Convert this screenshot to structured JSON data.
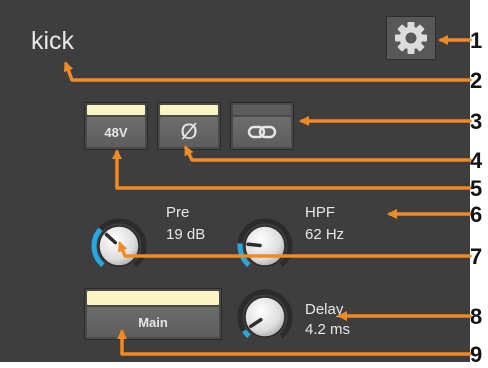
{
  "channel": {
    "name": "kick"
  },
  "buttons": {
    "phantom": {
      "label": "48V"
    },
    "polarity": {
      "glyph": "Ø"
    },
    "link": {
      "icon": "link-icon"
    },
    "output": {
      "label": "Main"
    }
  },
  "knobs": {
    "preamp": {
      "label": "Pre",
      "value": "19 dB",
      "level": 0.33
    },
    "hpf": {
      "label": "HPF",
      "value": "62 Hz",
      "level": 0.2
    },
    "delay": {
      "label": "Delay",
      "value": "4.2 ms",
      "level": 0.06
    }
  },
  "callouts": [
    "1",
    "2",
    "3",
    "4",
    "5",
    "6",
    "7",
    "8",
    "9"
  ],
  "colors": {
    "panel": "#3e3e3e",
    "lamp_on": "#fbf5c6",
    "lamp_off": "#5c5c5c",
    "arc": "#28a8e0",
    "annotation": "#f08a24"
  }
}
